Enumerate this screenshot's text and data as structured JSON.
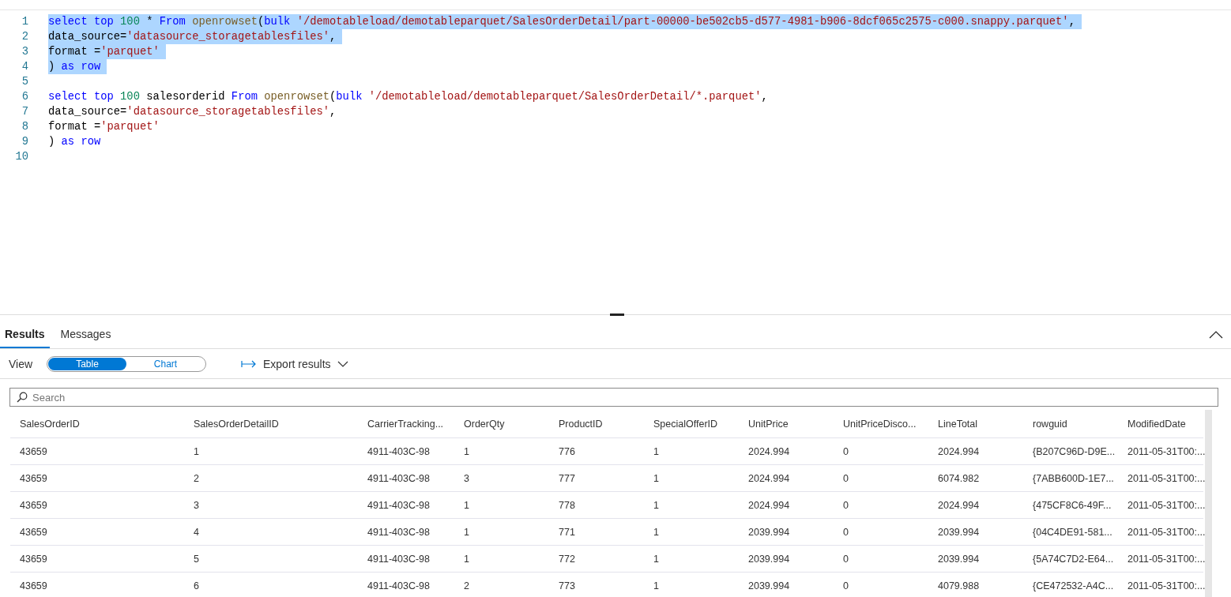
{
  "editor": {
    "lines": [
      {
        "number": "1",
        "selected": true,
        "tokens": [
          {
            "kind": "keyword",
            "text": "select"
          },
          {
            "kind": "keyword",
            "text": " top"
          },
          {
            "kind": "number",
            "text": " 100"
          },
          {
            "kind": "plain",
            "text": " *"
          },
          {
            "kind": "keyword",
            "text": " From"
          },
          {
            "kind": "function",
            "text": " openrowset"
          },
          {
            "kind": "plain",
            "text": "("
          },
          {
            "kind": "keyword",
            "text": "bulk"
          },
          {
            "kind": "string",
            "text": " '/demotableload/demotableparquet/SalesOrderDetail/part-00000-be502cb5-d577-4981-b906-8dcf065c2575-c000.snappy.parquet'"
          },
          {
            "kind": "plain",
            "text": ","
          }
        ]
      },
      {
        "number": "2",
        "selected": true,
        "tokens": [
          {
            "kind": "plain",
            "text": "data_source="
          },
          {
            "kind": "string",
            "text": "'datasource_storagetablesfiles'"
          },
          {
            "kind": "plain",
            "text": ","
          }
        ]
      },
      {
        "number": "3",
        "selected": true,
        "tokens": [
          {
            "kind": "plain",
            "text": "format ="
          },
          {
            "kind": "string",
            "text": "'parquet'"
          }
        ]
      },
      {
        "number": "4",
        "selected": true,
        "tokens": [
          {
            "kind": "plain",
            "text": ")"
          },
          {
            "kind": "keyword",
            "text": " as"
          },
          {
            "kind": "keyword",
            "text": " row"
          }
        ]
      },
      {
        "number": "5"
      },
      {
        "number": "6",
        "selected": false,
        "tokens": [
          {
            "kind": "keyword",
            "text": "select"
          },
          {
            "kind": "keyword",
            "text": " top"
          },
          {
            "kind": "number",
            "text": " 100"
          },
          {
            "kind": "plain",
            "text": " salesorderid"
          },
          {
            "kind": "keyword",
            "text": " From"
          },
          {
            "kind": "function",
            "text": " openrowset"
          },
          {
            "kind": "plain",
            "text": "("
          },
          {
            "kind": "keyword",
            "text": "bulk"
          },
          {
            "kind": "string",
            "text": " '/demotableload/demotableparquet/SalesOrderDetail/*.parquet'"
          },
          {
            "kind": "plain",
            "text": ","
          }
        ]
      },
      {
        "number": "7",
        "selected": false,
        "tokens": [
          {
            "kind": "plain",
            "text": "data_source="
          },
          {
            "kind": "string",
            "text": "'datasource_storagetablesfiles'"
          },
          {
            "kind": "plain",
            "text": ","
          }
        ]
      },
      {
        "number": "8",
        "selected": false,
        "tokens": [
          {
            "kind": "plain",
            "text": "format ="
          },
          {
            "kind": "string",
            "text": "'parquet'"
          }
        ]
      },
      {
        "number": "9",
        "selected": false,
        "tokens": [
          {
            "kind": "plain",
            "text": ")"
          },
          {
            "kind": "keyword",
            "text": " as"
          },
          {
            "kind": "keyword",
            "text": " row"
          }
        ]
      },
      {
        "number": "10"
      }
    ]
  },
  "results": {
    "tabs": [
      {
        "label": "Results",
        "selected": true
      },
      {
        "label": "Messages",
        "selected": false
      }
    ],
    "view_label": "View",
    "view_toggle": [
      {
        "label": "Table",
        "selected": true
      },
      {
        "label": "Chart",
        "selected": false
      }
    ],
    "export_button": "Export results",
    "search": {
      "placeholder": "Search"
    },
    "table": {
      "columns": [
        "SalesOrderID",
        "SalesOrderDetailID",
        "CarrierTracking...",
        "OrderQty",
        "ProductID",
        "SpecialOfferID",
        "UnitPrice",
        "UnitPriceDisco...",
        "LineTotal",
        "rowguid",
        "ModifiedDate"
      ],
      "rows": [
        [
          "43659",
          "1",
          "4911-403C-98",
          "1",
          "776",
          "1",
          "2024.994",
          "0",
          "2024.994",
          "{B207C96D-D9E...",
          "2011-05-31T00:..."
        ],
        [
          "43659",
          "2",
          "4911-403C-98",
          "3",
          "777",
          "1",
          "2024.994",
          "0",
          "6074.982",
          "{7ABB600D-1E7...",
          "2011-05-31T00:..."
        ],
        [
          "43659",
          "3",
          "4911-403C-98",
          "1",
          "778",
          "1",
          "2024.994",
          "0",
          "2024.994",
          "{475CF8C6-49F...",
          "2011-05-31T00:..."
        ],
        [
          "43659",
          "4",
          "4911-403C-98",
          "1",
          "771",
          "1",
          "2039.994",
          "0",
          "2039.994",
          "{04C4DE91-581...",
          "2011-05-31T00:..."
        ],
        [
          "43659",
          "5",
          "4911-403C-98",
          "1",
          "772",
          "1",
          "2039.994",
          "0",
          "2039.994",
          "{5A74C7D2-E64...",
          "2011-05-31T00:..."
        ],
        [
          "43659",
          "6",
          "4911-403C-98",
          "2",
          "773",
          "1",
          "2039.994",
          "0",
          "4079.988",
          "{CE472532-A4C...",
          "2011-05-31T00:..."
        ]
      ]
    }
  }
}
